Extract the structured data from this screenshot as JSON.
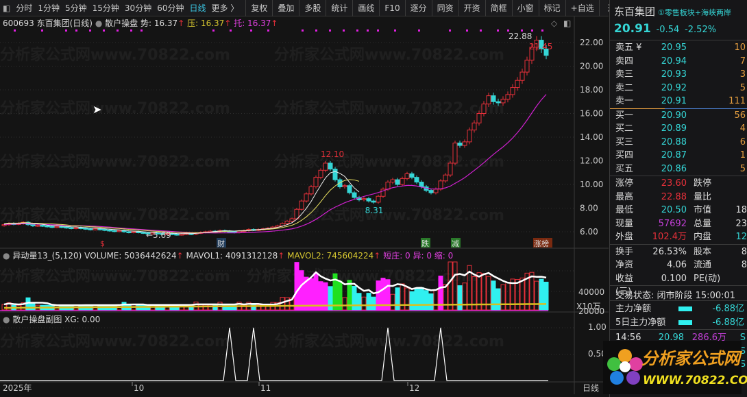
{
  "toolbar": {
    "items": [
      "分时",
      "1分钟",
      "5分钟",
      "15分钟",
      "30分钟",
      "60分钟",
      "日线",
      "更多 〉"
    ],
    "buttons": [
      "复权",
      "叠加",
      "多股",
      "统计",
      "画线",
      "F10",
      "逐分",
      "同资",
      "开资",
      "简框",
      "小窗",
      "标记",
      "+自选",
      "返回"
    ]
  },
  "main": {
    "code_title": "600693 东百集团(日线)",
    "indicator": "散户操盘",
    "shi": "势: 16.37",
    "ya": "压: 16.37",
    "tuo": "托: 16.37",
    "labels": {
      "high": "22.88",
      "last": "21.45",
      "peak": "12.10",
      "trough": "8.31",
      "low": "←5.69"
    },
    "markers": [
      "$",
      "财",
      "跌",
      "减",
      "涨榜"
    ],
    "price_ticks": [
      "22.00",
      "20.00",
      "18.00",
      "16.00",
      "14.00",
      "12.00",
      "10.00",
      "8.00",
      "6.00"
    ]
  },
  "volume": {
    "title": "异动量13_(5,120)",
    "volume": "VOLUME: 5036442624",
    "mavol1": "MAVOL1: 4091312128",
    "mavol2": "MAVOL2: 745604224",
    "flags": "短庄: 0 异: 0 缩: 0",
    "ticks": [
      "40000",
      "20000"
    ],
    "unit": "X10万"
  },
  "sub": {
    "title": "散户操盘副图",
    "xg": "XG: 0.00",
    "ticks": [
      "1.00",
      "0.50"
    ]
  },
  "xaxis": {
    "labels": [
      "2025年",
      "10",
      "11",
      "12"
    ],
    "period": "日线"
  },
  "quote": {
    "name": "东百集团",
    "sectors": "①零售板块+海峡两岸",
    "price": "20.91",
    "change": "-0.54",
    "pct": "-2.52%",
    "asks": [
      {
        "l": "卖五 ¥",
        "p": "20.95",
        "v": "10"
      },
      {
        "l": "卖四",
        "p": "20.94",
        "v": "7"
      },
      {
        "l": "卖三",
        "p": "20.93",
        "v": "3"
      },
      {
        "l": "卖二",
        "p": "20.92",
        "v": "5"
      },
      {
        "l": "卖一",
        "p": "20.91",
        "v": "111"
      }
    ],
    "bids": [
      {
        "l": "买一",
        "p": "20.90",
        "v": "56"
      },
      {
        "l": "买二",
        "p": "20.89",
        "v": "4"
      },
      {
        "l": "买三",
        "p": "20.88",
        "v": "6"
      },
      {
        "l": "买四",
        "p": "20.87",
        "v": "1"
      },
      {
        "l": "买五",
        "p": "20.86",
        "v": "5"
      }
    ],
    "stats": [
      {
        "l": "涨停",
        "v": "23.60",
        "c": "red",
        "l2": "跌停",
        "v2": ""
      },
      {
        "l": "最高",
        "v": "22.88",
        "c": "red",
        "l2": "量比",
        "v2": ""
      },
      {
        "l": "最低",
        "v": "20.50",
        "c": "cyan",
        "l2": "市值",
        "v2": "18"
      },
      {
        "l": "现量",
        "v": "57692",
        "c": "mag",
        "l2": "总量",
        "v2": "23"
      },
      {
        "l": "外盘",
        "v": "102.4万",
        "c": "red",
        "l2": "内盘",
        "v2": "12"
      }
    ],
    "stats2": [
      {
        "l": "换手",
        "v": "26.53%",
        "l2": "股本",
        "v2": "8"
      },
      {
        "l": "净资",
        "v": "4.06",
        "l2": "流通",
        "v2": "8"
      },
      {
        "l": "收益(三)",
        "v": "0.100",
        "l2": "PE(动)",
        "v2": ""
      }
    ],
    "status": "交易状态: 闭市阶段 15:00:01",
    "flows": [
      {
        "l": "主力净额",
        "v": "-6.88亿"
      },
      {
        "l": "5日主力净额",
        "v": "-6.88亿"
      }
    ],
    "ticks": [
      {
        "t": "14:56",
        "p": "20.98",
        "a": "286.6万",
        "s": "S"
      },
      {
        "t": "14:56",
        "p": "20.95",
        "a": "219.3万",
        "s": "S"
      },
      {
        "t": "14:56",
        "p": "20.95",
        "a": "152.5万",
        "s": "S"
      }
    ],
    "logo": {
      "cn": "分析家公式网",
      "url": "WWW.70822.COM"
    }
  },
  "watermark": "分析家公式网www.70822.com",
  "chart_data": {
    "type": "candlestick",
    "closes": [
      6.6,
      6.7,
      6.65,
      6.7,
      6.8,
      6.6,
      6.5,
      6.55,
      6.5,
      6.45,
      6.4,
      6.45,
      6.4,
      6.35,
      6.3,
      6.35,
      6.3,
      6.25,
      6.2,
      6.25,
      6.2,
      6.15,
      6.1,
      6.05,
      6.1,
      6.0,
      5.95,
      6.0,
      5.95,
      5.9,
      5.85,
      5.9,
      5.85,
      5.8,
      5.85,
      5.8,
      5.75,
      5.8,
      5.85,
      5.8,
      5.9,
      5.95,
      6.0,
      6.05,
      6.0,
      6.1,
      6.05,
      6.0,
      5.95,
      6.05,
      6.1,
      6.2,
      6.15,
      6.2,
      6.25,
      6.3,
      6.4,
      6.5,
      6.7,
      6.9,
      7.1,
      7.9,
      8.6,
      9.2,
      9.8,
      10.6,
      11.2,
      11.8,
      11.3,
      10.4,
      9.8,
      9.9,
      9.3,
      8.9,
      8.7,
      8.8,
      8.6,
      8.5,
      9.0,
      9.6,
      10.2,
      10.4,
      10.0,
      10.5,
      10.9,
      10.6,
      10.2,
      9.8,
      9.5,
      9.3,
      9.6,
      10.3,
      10.8,
      11.8,
      13.5,
      13.3,
      13.6,
      14.6,
      15.2,
      16.0,
      16.8,
      17.5,
      17.0,
      16.9,
      17.2,
      17.6,
      18.2,
      18.8,
      19.5,
      20.5,
      21.6,
      22.2,
      21.45,
      20.91
    ],
    "ylim": [
      5.5,
      23
    ],
    "xg_signal_indices": [
      47,
      52,
      80,
      91
    ]
  }
}
